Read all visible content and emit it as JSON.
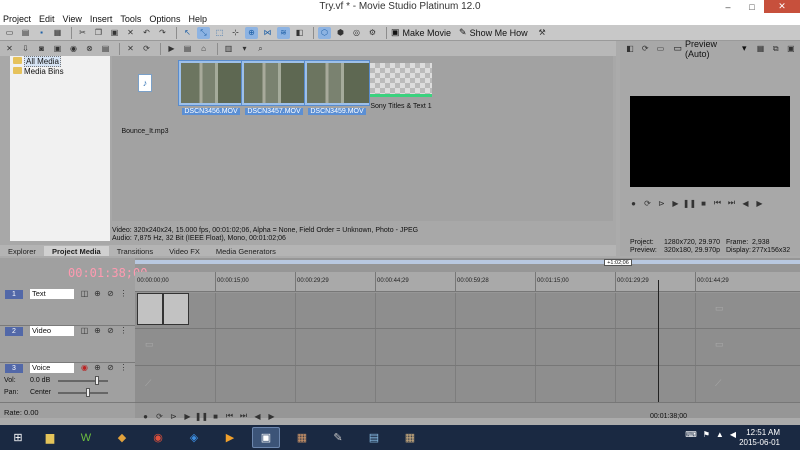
{
  "window": {
    "title": "Try.vf * - Movie Studio Platinum 12.0",
    "min": "–",
    "max": "□",
    "close": "✕"
  },
  "menu": [
    "Project",
    "Edit",
    "View",
    "Insert",
    "Tools",
    "Options",
    "Help"
  ],
  "toolbar": {
    "make_movie": "Make Movie",
    "show_me_how": "Show Me How"
  },
  "tree": {
    "items": [
      "All Media",
      "Media Bins"
    ]
  },
  "media": {
    "items": [
      {
        "caption": "Bounce_It.mp3",
        "type": "audio"
      },
      {
        "caption": "DSCN3456.MOV",
        "type": "video",
        "selected": true
      },
      {
        "caption": "DSCN3457.MOV",
        "type": "video",
        "selected": true
      },
      {
        "caption": "DSCN3459.MOV",
        "type": "video",
        "selected": true
      },
      {
        "caption": "Sony Titles & Text 1",
        "type": "generator"
      }
    ],
    "info_line1": "Video: 320x240x24, 15.000 fps, 00:01:02;06, Alpha = None, Field Order = Unknown, Photo - JPEG",
    "info_line2": "Audio: 7,875 Hz, 32 Bit (IEEE Float), Mono, 00:01:02;06"
  },
  "tabs": [
    "Explorer",
    "Project Media",
    "Transitions",
    "Video FX",
    "Media Generators"
  ],
  "preview": {
    "mode": "Preview (Auto)",
    "project_label": "Project:",
    "project_value": "1280x720, 29.970",
    "frame_label": "Frame:",
    "frame_value": "2,938",
    "preview_label": "Preview:",
    "preview_value": "320x180, 29.970p",
    "display_label": "Display:",
    "display_value": "277x156x32"
  },
  "timeline": {
    "timecode": "00:01:38;00",
    "marker": "+1:02;06",
    "ruler": [
      "00:00:00;00",
      "00:00:15;00",
      "00:00:29;29",
      "00:00:44;29",
      "00:00:59;28",
      "00:01:15;00",
      "00:01:29;29",
      "00:01:44;29"
    ],
    "tracks": [
      {
        "num": "1",
        "name": "Text"
      },
      {
        "num": "2",
        "name": "Video"
      },
      {
        "num": "3",
        "name": "Voice",
        "vol_label": "Vol:",
        "vol_value": "0.0 dB",
        "pan_label": "Pan:",
        "pan_value": "Center"
      }
    ],
    "rate": "Rate: 0.00",
    "end_time": "00:01:38;00"
  },
  "taskbar": {
    "time": "12:51 AM",
    "date": "2015-06-01"
  },
  "colors": {
    "selection": "#9dc0ea",
    "timecode": "#ff9ab0",
    "taskbar": "#1a2942",
    "close": "#c7503c"
  }
}
